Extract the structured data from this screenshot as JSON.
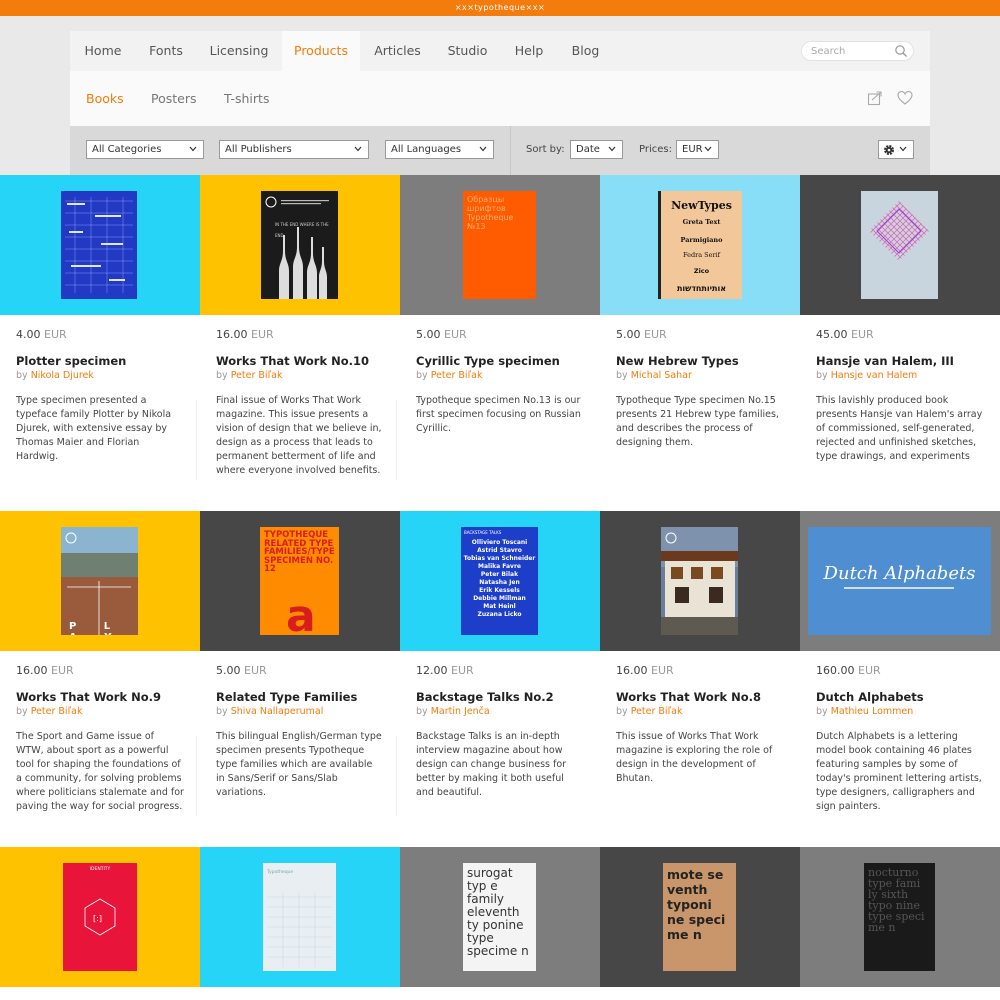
{
  "brand": "×x×typotheque×x×",
  "nav": {
    "items": [
      "Home",
      "Fonts",
      "Licensing",
      "Products",
      "Articles",
      "Studio",
      "Help",
      "Blog"
    ],
    "active": "Products",
    "search_placeholder": "Search"
  },
  "subnav": {
    "items": [
      "Books",
      "Posters",
      "T-shirts"
    ],
    "active": "Books",
    "icons": [
      "share-icon",
      "heart-icon"
    ]
  },
  "filters": {
    "categories": "All Categories",
    "publishers": "All Publishers",
    "languages": "All Languages",
    "sort_label": "Sort by:",
    "sort_value": "Date",
    "prices_label": "Prices:",
    "prices_value": "EUR",
    "settings_icon": "gear-icon"
  },
  "colors": {
    "accent": "#f47c0d",
    "cyan": "#25d4f6",
    "yellow": "#ffc200",
    "gray": "#7d7d7d",
    "lightcyan": "#88def6",
    "dark": "#474747"
  },
  "products": [
    {
      "price": "4.00",
      "currency": "EUR",
      "title": "Plotter specimen",
      "by": "by",
      "author": "Nikola Djurek",
      "desc": "Type specimen presented a typeface family Plotter by Nikola Djurek, with extensive essay by Thomas Maier and Florian Hardwig."
    },
    {
      "price": "16.00",
      "currency": "EUR",
      "title": "Works That Work No.10",
      "by": "by",
      "author": "Peter Biľak",
      "desc": "Final issue of Works That Work magazine. This issue presents a vision of design that we believe in, design as a process that leads to permanent betterment of life and where everyone involved benefits.",
      "cover_text": "IN THE END WHERE IS THE END"
    },
    {
      "price": "5.00",
      "currency": "EUR",
      "title": "Cyrillic Type specimen",
      "by": "by",
      "author": "Peter Biľak",
      "desc": "Typotheque specimen No.13 is our first specimen focusing on Russian Cyrillic.",
      "cover_text": "Образцы шрифтов Typotheque №13"
    },
    {
      "price": "5.00",
      "currency": "EUR",
      "title": "New Hebrew Types",
      "by": "by",
      "author": "Michal Sahar",
      "desc": "Typotheque Type specimen No.15 presents 21 Hebrew type families, and describes the process of designing them.",
      "cover_text": [
        "NewTypes",
        "Greta Text",
        "Parmigiano",
        "Fedra Serif",
        "Zico",
        "אותיותחדשות"
      ]
    },
    {
      "price": "45.00",
      "currency": "EUR",
      "title": "Hansje van Halem, III",
      "by": "by",
      "author": "Hansje van Halem",
      "desc": "This lavishly produced book presents Hansje van Halem's array of commissioned, self-generated, rejected and unfinished sketches, type drawings, and experiments"
    },
    {
      "price": "16.00",
      "currency": "EUR",
      "title": "Works That Work No.9",
      "by": "by",
      "author": "Peter Biľak",
      "desc": "The Sport and Game issue of WTW, about sport as a powerful tool for shaping the foundations of a community, for solving problems where politicians stalemate and for paving the way for social progress.",
      "cover_text": "P L A Y"
    },
    {
      "price": "5.00",
      "currency": "EUR",
      "title": "Related Type Families",
      "by": "by",
      "author": "Shiva Nallaperumal",
      "desc": "This bilingual English/German type specimen presents Typotheque type families which are available in Sans/Serif or Sans/Slab variations.",
      "cover_text": "TYPOTHEQUE RELATED TYPE FAMILIES/TYPE SPECIMEN NO. 12"
    },
    {
      "price": "12.00",
      "currency": "EUR",
      "title": "Backstage Talks No.2",
      "by": "by",
      "author": "Martin Jenča",
      "desc": "Backstage Talks is an in-depth interview magazine about how design can change business for better by making it both useful and beautiful.",
      "cover_text": [
        "BACKSTAGE TALKS",
        "Olliviero Toscani",
        "Astrid Stavro",
        "Tobias van Schneider",
        "Malika Favre",
        "Peter Bilak",
        "Natasha Jen",
        "Erik Kessels",
        "Debbie Millman",
        "Mat Heinl",
        "Zuzana Licko"
      ]
    },
    {
      "price": "16.00",
      "currency": "EUR",
      "title": "Works That Work No.8",
      "by": "by",
      "author": "Peter Biľak",
      "desc": "This issue of Works That Work magazine is exploring the role of design in the development of Bhutan."
    },
    {
      "price": "160.00",
      "currency": "EUR",
      "title": "Dutch Alphabets",
      "by": "by",
      "author": "Mathieu Lommen",
      "desc": "Dutch Alphabets is a lettering model book containing 46 plates featuring samples by some of today's prominent lettering artists, type designers, calligraphers and sign painters.",
      "cover_text": "Dutch Alphabets"
    },
    {
      "cover_text": "IDENTITY"
    },
    {
      "cover_text": "Typotheque"
    },
    {
      "cover_text": "surogat typ e family eleventh ty ponine type specime n"
    },
    {
      "cover_text": "mote se venth typoni ne speci me n"
    },
    {
      "cover_text": "nocturno type fami ly sixth typo nine type speci me n"
    }
  ]
}
